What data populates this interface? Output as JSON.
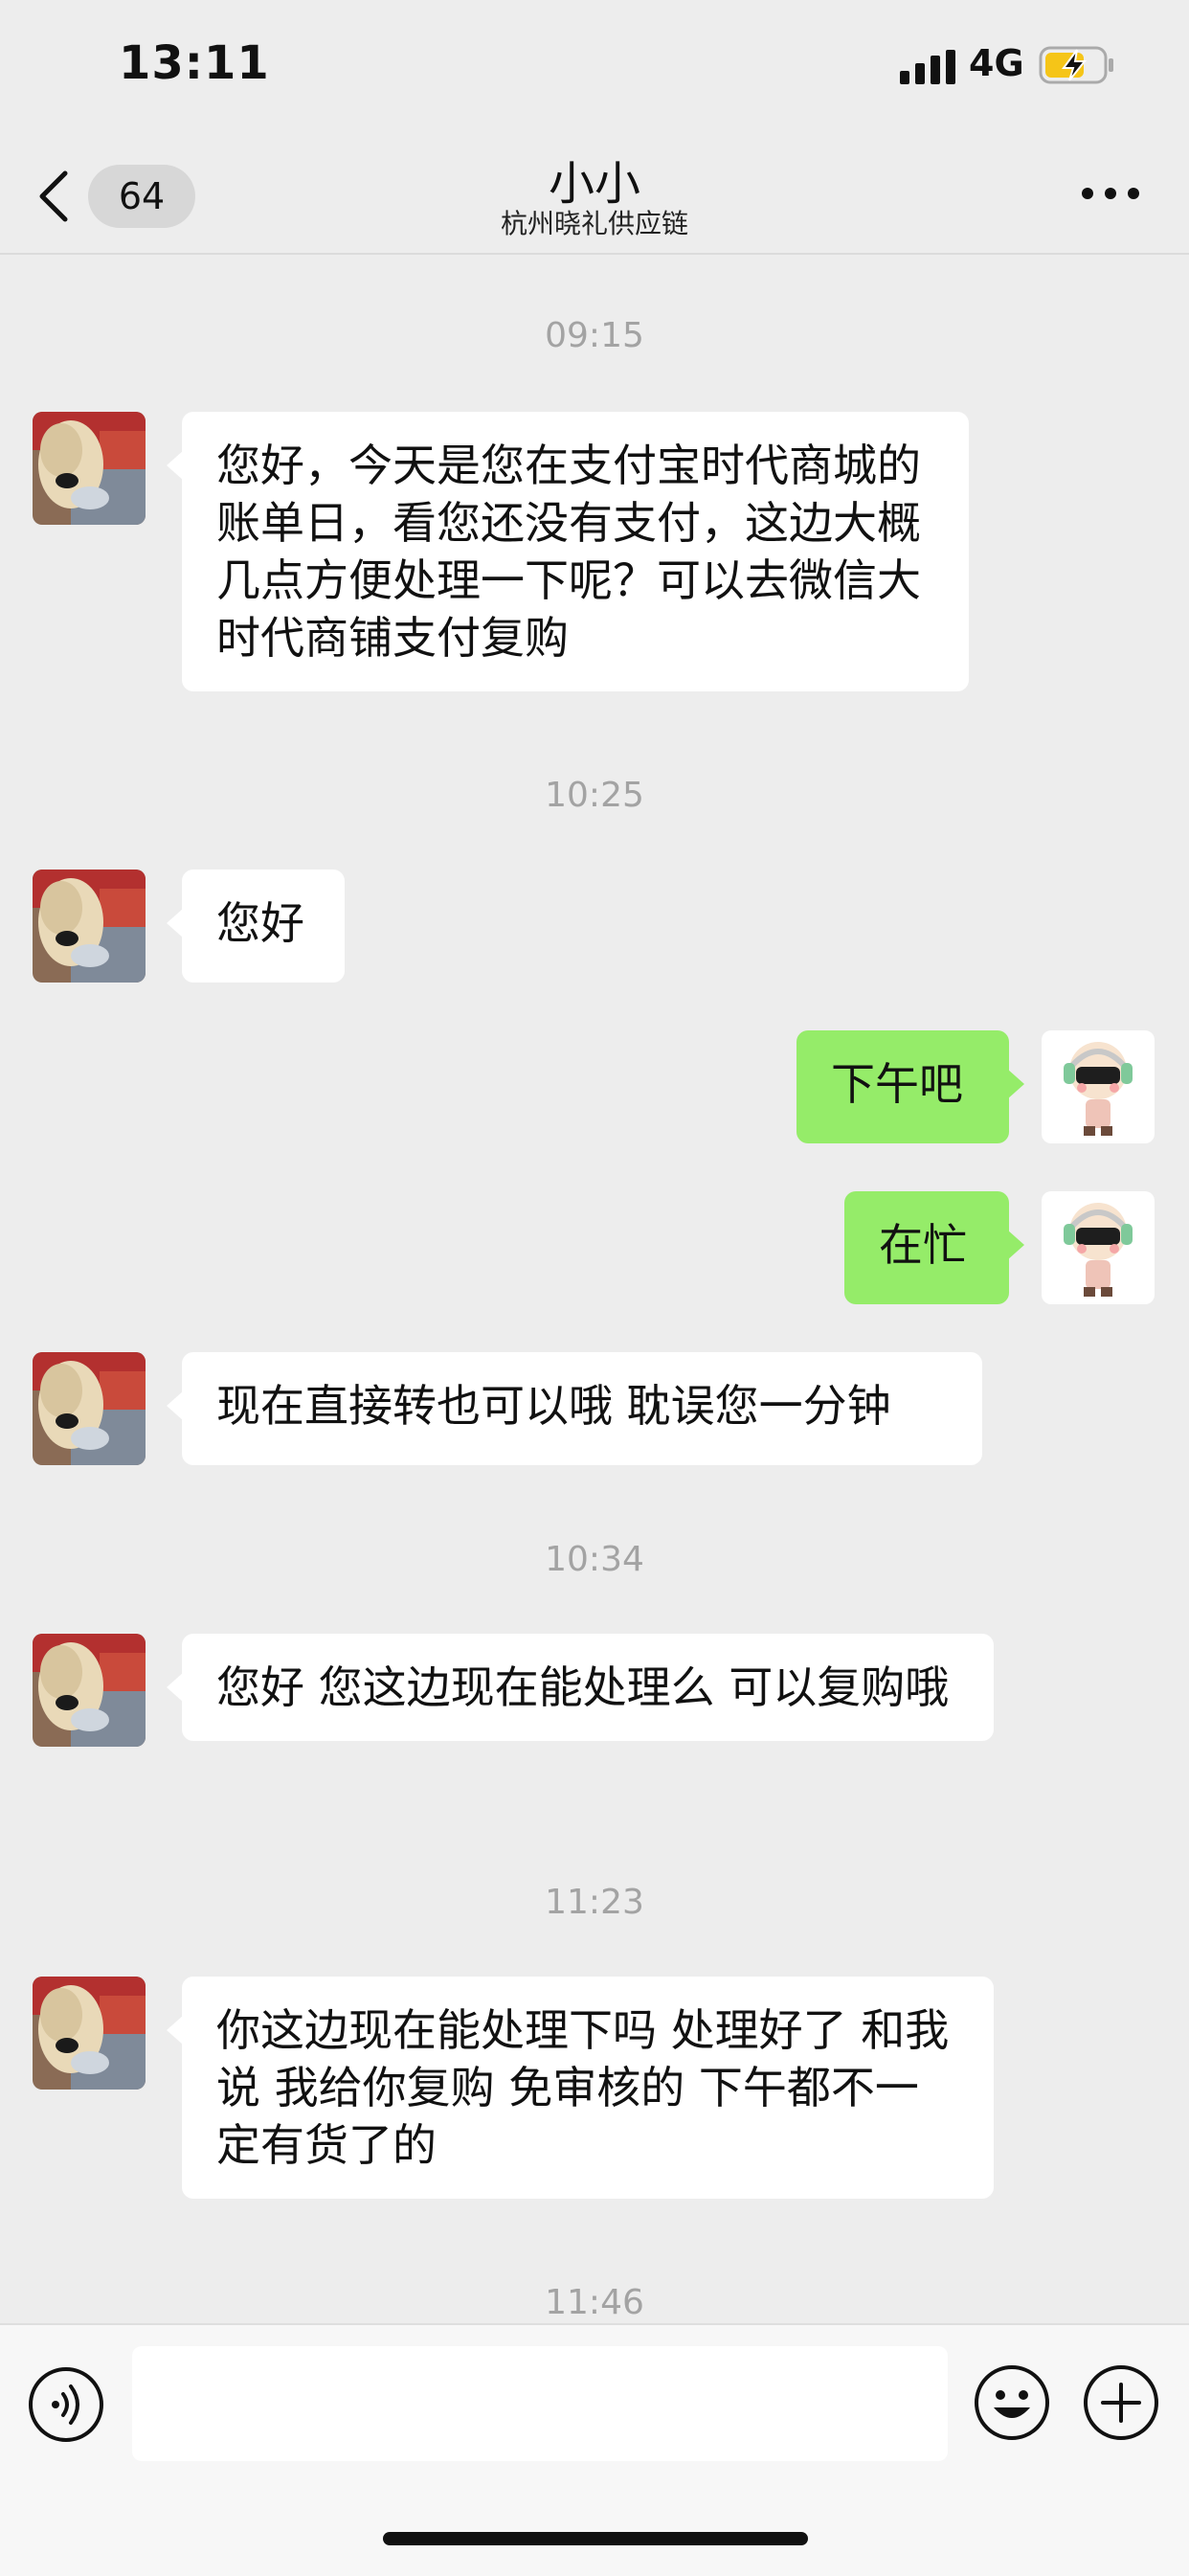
{
  "status_bar": {
    "time": "13:11",
    "network": "4G",
    "battery_charging": true
  },
  "nav": {
    "back_count": "64",
    "title": "小小",
    "subtitle": "杭州晓礼供应链",
    "icons": {
      "back": "chevron-left-icon",
      "more": "more-dots-icon"
    }
  },
  "chat": {
    "timestamps": [
      "09:15",
      "10:25",
      "10:34",
      "11:23",
      "11:46"
    ],
    "messages": [
      {
        "side": "in",
        "text": "您好，今天是您在支付宝时代商城的账单日，看您还没有支付，这边大概几点方便处理一下呢？可以去微信大时代商铺支付复购"
      },
      {
        "side": "in",
        "text": "您好"
      },
      {
        "side": "out",
        "text": "下午吧"
      },
      {
        "side": "out",
        "text": "在忙"
      },
      {
        "side": "in",
        "text": "现在直接转也可以哦 耽误您一分钟"
      },
      {
        "side": "in",
        "text": "您好 您这边现在能处理么 可以复购哦"
      },
      {
        "side": "in",
        "text": "你这边现在能处理下吗 处理好了 和我说 我给你复购 免审核的 下午都不一定有货了的"
      }
    ]
  },
  "input_bar": {
    "placeholder": "",
    "icons": {
      "voice": "voice-icon",
      "emoji": "emoji-icon",
      "more": "plus-icon"
    }
  },
  "colors": {
    "bubble_out": "#95ec69",
    "bubble_in": "#ffffff",
    "background": "#ededed",
    "timestamp": "#a3a3a3"
  }
}
